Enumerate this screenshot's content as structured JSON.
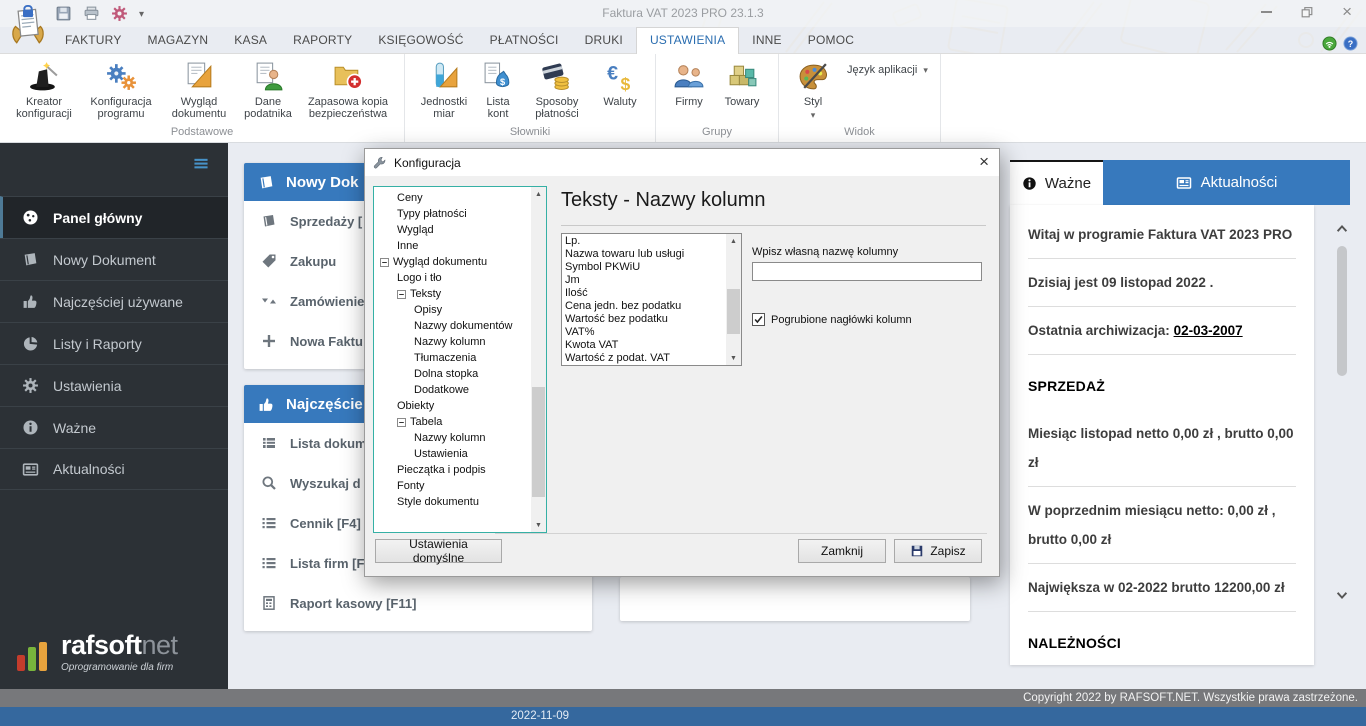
{
  "titlebar": {
    "title": "Faktura VAT 2023 PRO 23.1.3"
  },
  "tabs": {
    "items": [
      "FAKTURY",
      "MAGAZYN",
      "KASA",
      "RAPORTY",
      "KSIĘGOWOŚĆ",
      "PŁATNOŚCI",
      "DRUKI",
      "USTAWIENIA",
      "INNE",
      "POMOC"
    ],
    "active": "USTAWIENIA"
  },
  "ribbon": {
    "groups": [
      {
        "label": "Podstawowe",
        "items": [
          {
            "label": "Kreator konfiguracji"
          },
          {
            "label": "Konfiguracja programu"
          },
          {
            "label": "Wygląd dokumentu"
          },
          {
            "label": "Dane podatnika"
          },
          {
            "label": "Zapasowa kopia bezpieczeństwa"
          }
        ]
      },
      {
        "label": "Słowniki",
        "items": [
          {
            "label": "Jednostki miar"
          },
          {
            "label": "Lista kont"
          },
          {
            "label": "Sposoby płatności"
          },
          {
            "label": "Waluty"
          }
        ]
      },
      {
        "label": "Grupy",
        "items": [
          {
            "label": "Firmy"
          },
          {
            "label": "Towary"
          }
        ]
      },
      {
        "label": "Widok",
        "items": [
          {
            "label": "Styl"
          },
          {
            "label": "Język aplikacji"
          }
        ]
      }
    ]
  },
  "sidebar": {
    "items": [
      {
        "label": "Panel główny",
        "icon": "dashboard-icon",
        "active": true
      },
      {
        "label": "Nowy Dokument",
        "icon": "book-icon"
      },
      {
        "label": "Najczęściej używane",
        "icon": "thumb-up-icon"
      },
      {
        "label": "Listy i Raporty",
        "icon": "pie-chart-icon"
      },
      {
        "label": "Ustawienia",
        "icon": "gear-icon"
      },
      {
        "label": "Ważne",
        "icon": "info-icon"
      },
      {
        "label": "Aktualności",
        "icon": "news-icon"
      }
    ],
    "logo": {
      "brand_bold": "rafsoft",
      "brand_light": "net",
      "tagline": "Oprogramowanie dla firm"
    }
  },
  "panels": {
    "new_document": {
      "title": "Nowy Dok",
      "items": [
        {
          "label": "Sprzedaży [",
          "icon": "book-icon"
        },
        {
          "label": "Zakupu",
          "icon": "tag-icon"
        },
        {
          "label": "Zamówienie",
          "icon": "order-arrows-icon"
        },
        {
          "label": "Nowa Faktu",
          "icon": "plus-icon"
        }
      ]
    },
    "most_used": {
      "title": "Najczęście",
      "items": [
        {
          "label": "Lista dokum",
          "icon": "table-icon"
        },
        {
          "label": "Wyszukaj d",
          "icon": "search-icon"
        },
        {
          "label": "Cennik [F4]",
          "icon": "list-icon"
        },
        {
          "label": "Lista firm [F",
          "icon": "list-icon"
        },
        {
          "label": "Raport kasowy [F11]",
          "icon": "report-icon"
        }
      ]
    }
  },
  "dialog": {
    "title": "Konfiguracja",
    "heading": "Teksty - Nazwy kolumn",
    "tree": [
      {
        "label": "Ceny",
        "depth": 1
      },
      {
        "label": "Typy płatności",
        "depth": 1
      },
      {
        "label": "Wygląd",
        "depth": 1
      },
      {
        "label": "Inne",
        "depth": 1
      },
      {
        "label": "Wygląd dokumentu",
        "depth": 0,
        "expander": true
      },
      {
        "label": "Logo i tło",
        "depth": 1
      },
      {
        "label": "Teksty",
        "depth": 1,
        "expander": true
      },
      {
        "label": "Opisy",
        "depth": 2
      },
      {
        "label": "Nazwy dokumentów",
        "depth": 2
      },
      {
        "label": "Nazwy kolumn",
        "depth": 2
      },
      {
        "label": "Tłumaczenia",
        "depth": 2
      },
      {
        "label": "Dolna stopka",
        "depth": 2
      },
      {
        "label": "Dodatkowe",
        "depth": 2
      },
      {
        "label": "Obiekty",
        "depth": 1
      },
      {
        "label": "Tabela",
        "depth": 1,
        "expander": true
      },
      {
        "label": "Nazwy kolumn",
        "depth": 2
      },
      {
        "label": "Ustawienia",
        "depth": 2
      },
      {
        "label": "Pieczątka i podpis",
        "depth": 1
      },
      {
        "label": "Fonty",
        "depth": 1
      },
      {
        "label": "Style dokumentu",
        "depth": 1
      }
    ],
    "columns_list": [
      "Lp.",
      "Nazwa towaru lub usługi",
      "Symbol PKWiU",
      "Jm",
      "Ilość",
      "Cena jedn. bez podatku",
      "Wartość bez podatku",
      "VAT%",
      "Kwota VAT",
      "Wartość z podat. VAT"
    ],
    "input_label": "Wpisz własną nazwę kolumny",
    "input_value": "",
    "checkbox_label": "Pogrubione nagłówki kolumn",
    "checkbox_checked": true,
    "buttons": {
      "defaults": "Ustawienia domyślne",
      "close": "Zamknij",
      "save": "Zapisz"
    }
  },
  "right_panel": {
    "tabs": [
      {
        "label": "Ważne",
        "active": true
      },
      {
        "label": "Aktualności"
      }
    ],
    "blocks": [
      {
        "text": "Witaj w programie Faktura VAT 2023 PRO"
      },
      {
        "text": "Dzisiaj jest 09 listopad 2022 ."
      },
      {
        "text": "Ostatnia archiwizacja: ",
        "link": "02-03-2007"
      },
      {
        "heading": "SPRZEDAŻ"
      },
      {
        "text": "Miesiąc listopad netto 0,00 zł , brutto 0,00 zł"
      },
      {
        "text": "W poprzednim miesiącu netto: 0,00 zł , brutto 0,00 zł"
      },
      {
        "text": "Największa w 02-2022 brutto 12200,00 zł"
      },
      {
        "heading": "NALEŻNOŚCI"
      }
    ]
  },
  "footer": {
    "copyright": "Copyright 2022 by RAFSOFT.NET. Wszystkie prawa zastrzeżone.",
    "date": "2022-11-09"
  },
  "colors": {
    "accent": "#3779bd",
    "sidebar_bg": "#2c3136",
    "date_bar": "#35689e",
    "copyright_bg": "#77787b",
    "tree_focus_border": "#35b0a5"
  }
}
